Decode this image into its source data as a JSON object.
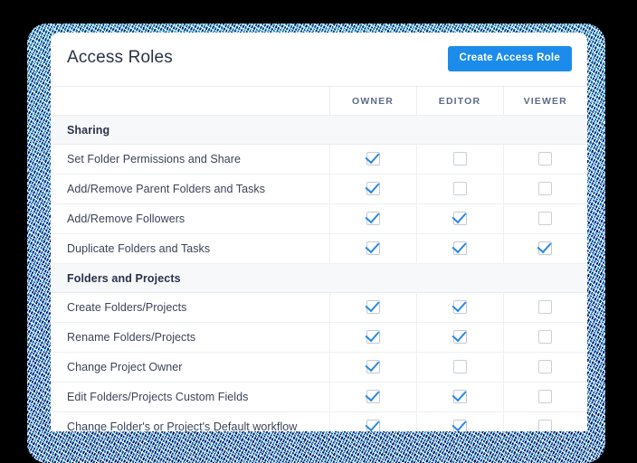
{
  "card": {
    "title": "Access Roles",
    "create_button_label": "Create Access Role"
  },
  "colors": {
    "accent": "#1b8ceb",
    "check": "#2b88e0",
    "title_text": "#2b3248",
    "header_text": "#5d6b89",
    "row_text": "#3c4359",
    "section_bg": "#f7f8fa",
    "border": "#eaecf0",
    "page_bg": "#000000"
  },
  "table": {
    "columns": [
      {
        "key": "name",
        "label": ""
      },
      {
        "key": "owner",
        "label": "OWNER"
      },
      {
        "key": "editor",
        "label": "EDITOR"
      },
      {
        "key": "viewer",
        "label": "VIEWER"
      }
    ],
    "sections": [
      {
        "title": "Sharing",
        "rows": [
          {
            "label": "Set Folder Permissions and Share",
            "owner": true,
            "editor": false,
            "viewer": false
          },
          {
            "label": "Add/Remove Parent Folders and Tasks",
            "owner": true,
            "editor": false,
            "viewer": false
          },
          {
            "label": "Add/Remove Followers",
            "owner": true,
            "editor": true,
            "viewer": false
          },
          {
            "label": "Duplicate Folders and Tasks",
            "owner": true,
            "editor": true,
            "viewer": true
          }
        ]
      },
      {
        "title": "Folders and Projects",
        "rows": [
          {
            "label": "Create Folders/Projects",
            "owner": true,
            "editor": true,
            "viewer": false
          },
          {
            "label": "Rename Folders/Projects",
            "owner": true,
            "editor": true,
            "viewer": false
          },
          {
            "label": "Change Project Owner",
            "owner": true,
            "editor": false,
            "viewer": false
          },
          {
            "label": "Edit Folders/Projects Custom Fields",
            "owner": true,
            "editor": true,
            "viewer": false
          },
          {
            "label": "Change Folder's or Project's Default workflow",
            "owner": true,
            "editor": true,
            "viewer": false
          }
        ]
      }
    ]
  }
}
